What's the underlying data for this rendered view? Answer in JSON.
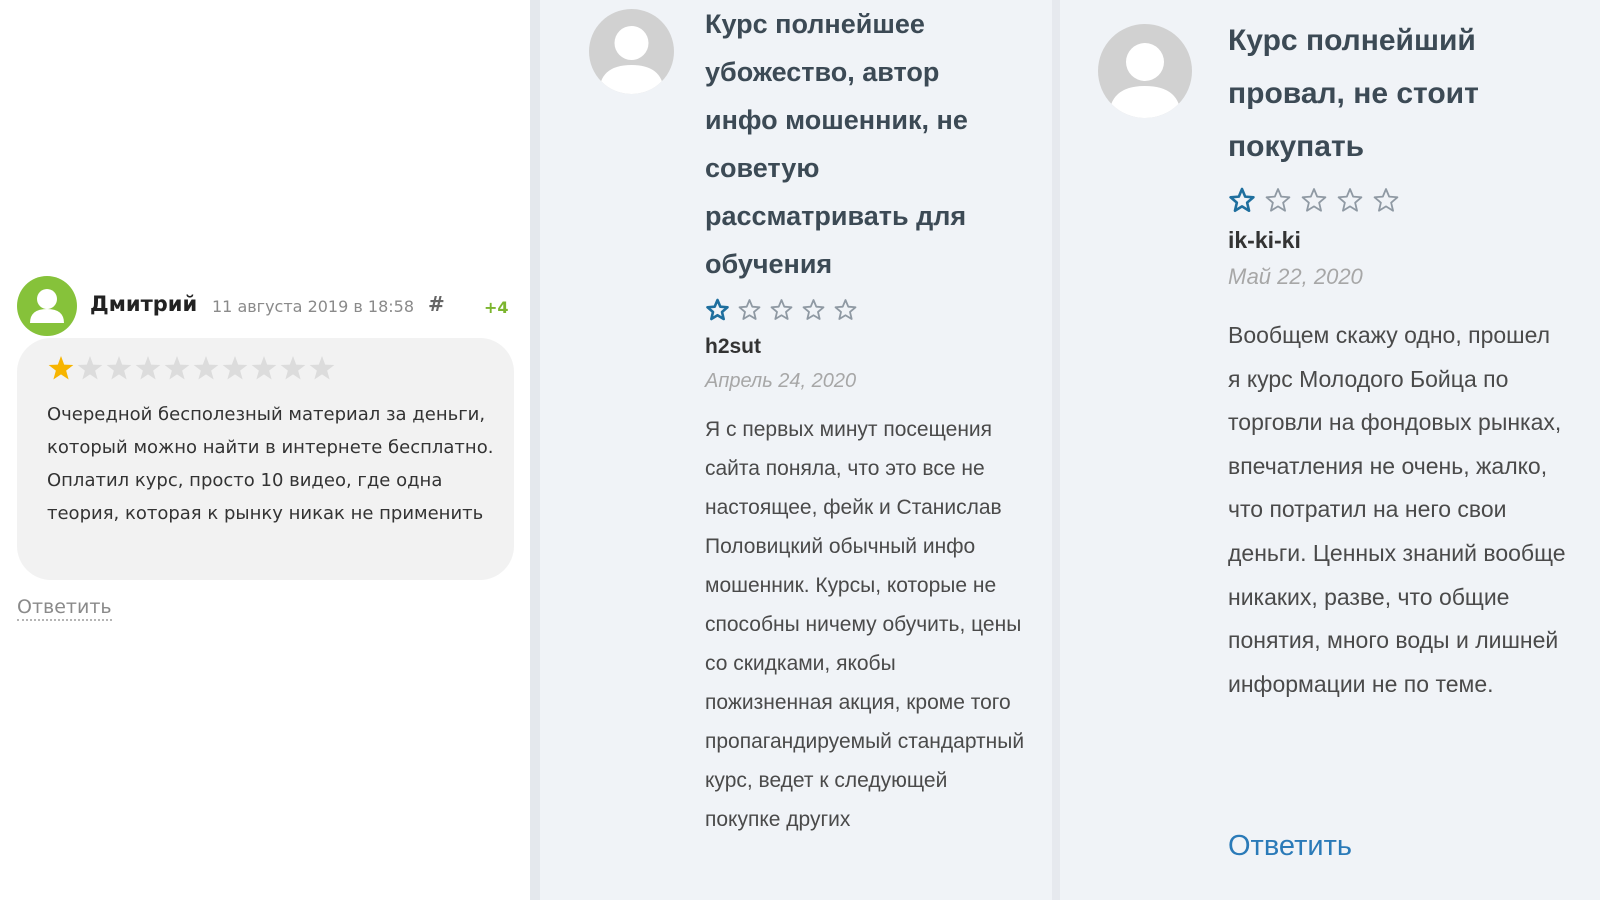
{
  "panel1": {
    "author": "Дмитрий",
    "date": "11 августа 2019 в 18:58",
    "hash": "#",
    "votes": "+4",
    "rating": 1,
    "rating_max": 10,
    "text": "Очередной бесполезный материал за деньги, который можно найти в интернете бесплатно. Оплатил курс, просто 10 видео, где одна теория, которая к рынку никак не применить",
    "reply_label": "Ответить",
    "colors": {
      "avatar": "#86c23a",
      "star_on": "#f7b500",
      "star_off": "#dcdcdc",
      "votes": "#7cb52e"
    }
  },
  "panel2": {
    "title": "Курс полнейшее убожество, автор инфо мошенник, не советую рассматривать для обучения",
    "rating": 1,
    "rating_max": 5,
    "user": "h2sut",
    "date": "Апрель 24, 2020",
    "body": "Я с первых минут посещения сайта поняла, что это все не настоящее, фейк и Станислав Половицкий обычный инфо мошенник. Курсы, которые не способны ничему обучить, цены со скидками, якобы пожизненная акция, кроме того пропагандируемый стандартный курс, ведет к следующей покупке других",
    "colors": {
      "star_on": "#1f6f9e",
      "star_off": "#8f99a3"
    }
  },
  "panel3": {
    "title": "Курс полнейший провал, не стоит покупать",
    "rating": 1,
    "rating_max": 5,
    "user": "ik-ki-ki",
    "date": "Май 22, 2020",
    "body": "Вообщем скажу одно, прошел я курс Молодого Бойца по торговли на фондовых рынках, впечатления не очень, жалко, что потратил на него свои деньги. Ценных знаний вообще никаких, разве, что общие понятия, много воды и лишней информации не по теме.",
    "reply_label": "Ответить",
    "colors": {
      "star_on": "#1f6f9e",
      "star_off": "#8f99a3",
      "reply": "#2a7ab8"
    }
  }
}
